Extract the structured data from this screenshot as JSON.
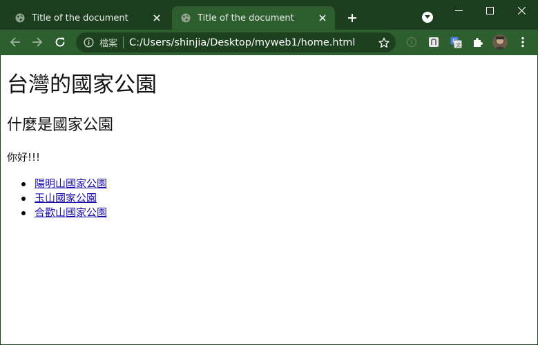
{
  "colors": {
    "titlebar_bg": "#1c3e1e",
    "toolbar_bg": "#2c5e2e",
    "omnibox_bg": "#1d401f",
    "link": "#1a0dab"
  },
  "tabs": [
    {
      "title": "Title of the document",
      "icon": "globe-icon",
      "active": false
    },
    {
      "title": "Title of the document",
      "icon": "globe-icon",
      "active": true
    }
  ],
  "toolbar": {
    "icons": [
      "back-arrow-icon",
      "forward-arrow-icon",
      "reload-icon",
      "info-icon",
      "star-icon",
      "extension-icons",
      "puzzle-icon",
      "avatar",
      "kebab-menu-icon"
    ],
    "omnibox": {
      "security_label": "檔案",
      "url": "C:/Users/shinjia/Desktop/myweb1/home.html"
    }
  },
  "page": {
    "h1": "台灣的國家公園",
    "h2": "什麼是國家公園",
    "paragraph": "你好!!!",
    "links": [
      "陽明山國家公園",
      "玉山國家公園",
      "合歡山國家公園"
    ]
  }
}
